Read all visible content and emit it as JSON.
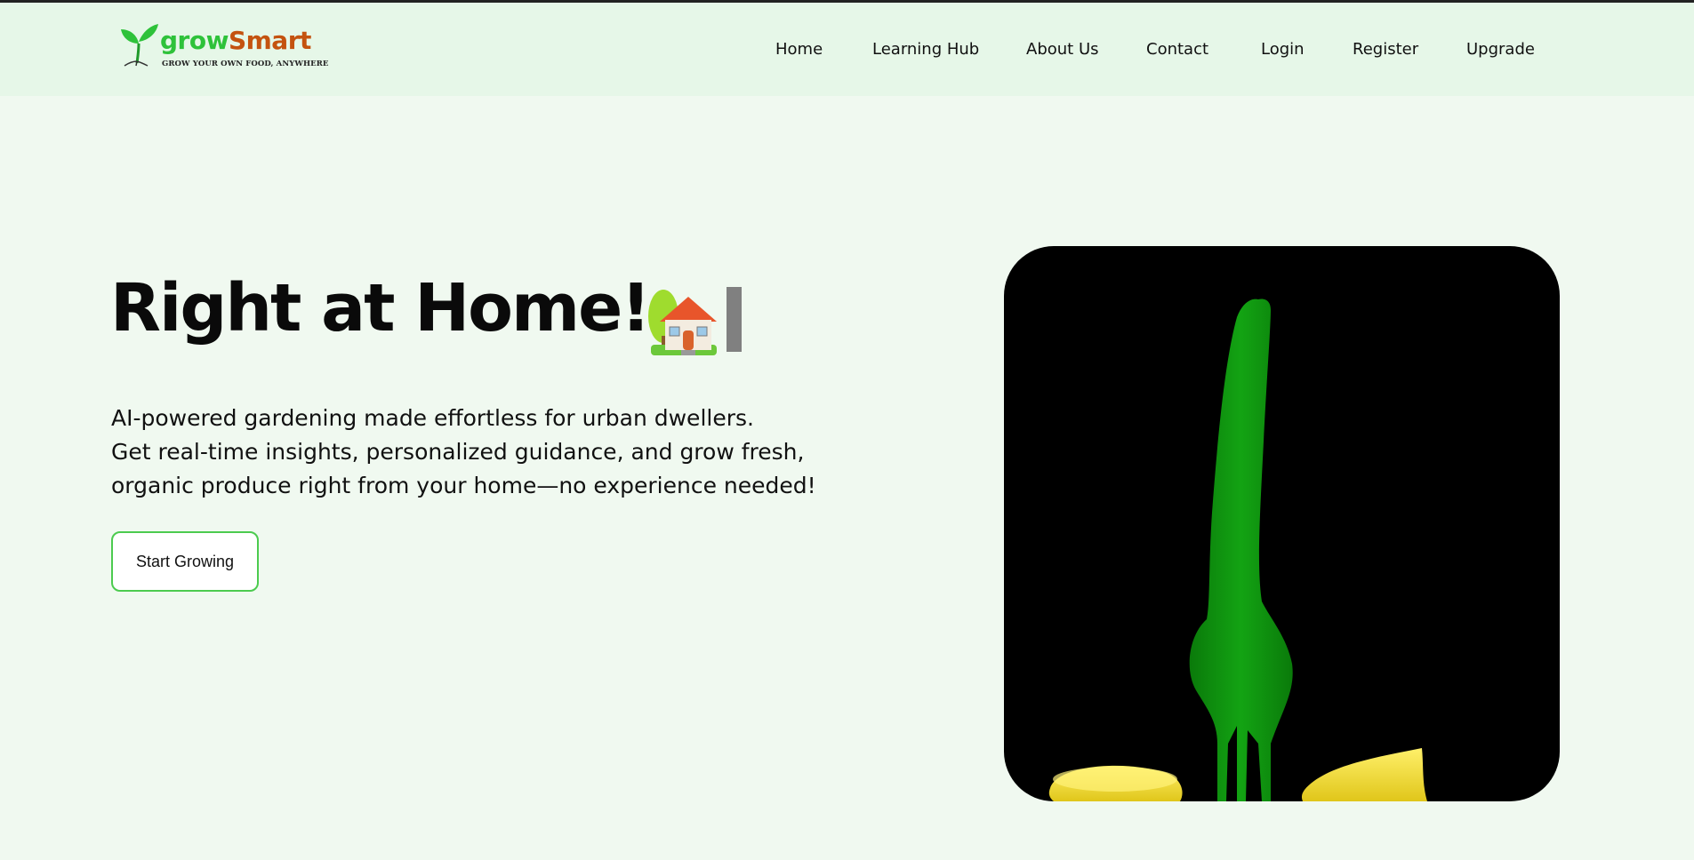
{
  "brand": {
    "name_part1": "grow",
    "name_part2": "Smart",
    "tagline": "GROW YOUR OWN FOOD, ANYWHERE",
    "icon": "sprout-icon",
    "colors": {
      "grow": "#2ec23a",
      "smart": "#c4520f"
    }
  },
  "nav": {
    "items": [
      "Home",
      "Learning Hub",
      "About Us",
      "Contact",
      "Login",
      "Register",
      "Upgrade"
    ]
  },
  "hero": {
    "title": "Right at Home!",
    "title_icon": "house-icon",
    "description_lines": [
      "AI-powered gardening made effortless for urban dwellers.",
      "Get real-time insights, personalized guidance, and grow fresh,",
      "organic produce right from your home—no experience needed!"
    ],
    "cta_label": "Start Growing",
    "media_icon": "fork-and-lemon-illustration"
  },
  "colors": {
    "page_bg": "#f0f9f0",
    "nav_bg": "#e6f7e8",
    "accent": "#4ccb4f",
    "fork": "#0c8a0c",
    "lemon": "#f2e024"
  }
}
